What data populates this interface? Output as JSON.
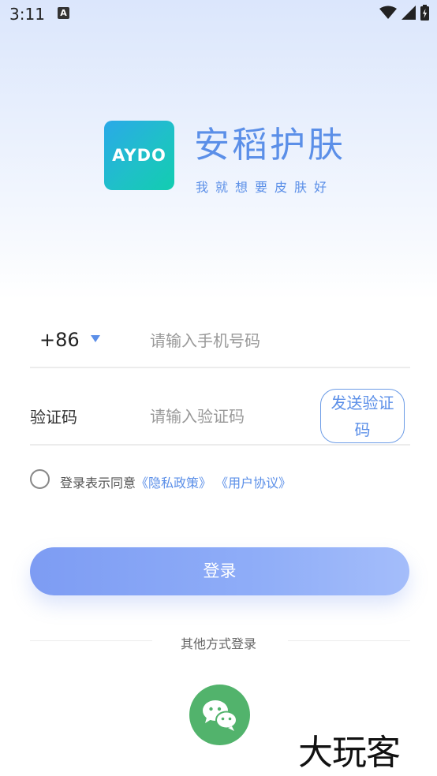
{
  "status_bar": {
    "time": "3:11",
    "notification_icon": "A"
  },
  "brand": {
    "logo_text": "AYDO",
    "name": "安稻护肤",
    "slogan": "我就想要皮肤好"
  },
  "form": {
    "country_code": "+86",
    "phone_placeholder": "请输入手机号码",
    "code_label": "验证码",
    "code_placeholder": "请输入验证码",
    "send_code_label": "发送验证码"
  },
  "agreement": {
    "prefix": "登录表示同意",
    "privacy_link": "《隐私政策》",
    "user_link": "《用户协议》"
  },
  "login_button": "登录",
  "other_login": {
    "label": "其他方式登录",
    "icon": "wechat-icon"
  },
  "watermark": "大玩客",
  "colors": {
    "accent": "#5b8fe8",
    "login_gradient_start": "#7d9cf3",
    "wechat": "#52b36c"
  }
}
